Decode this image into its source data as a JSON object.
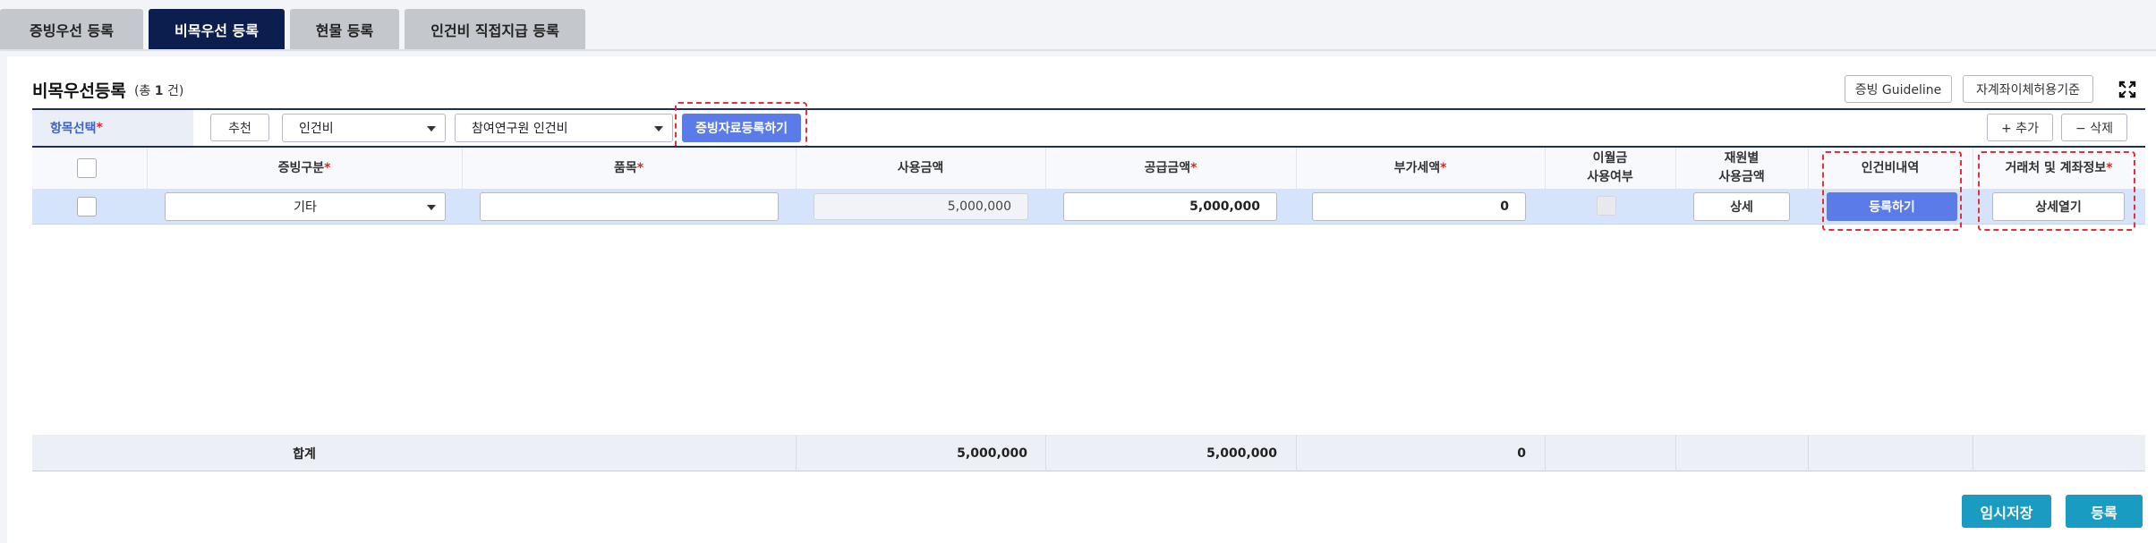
{
  "tabs": [
    "증빙우선 등록",
    "비목우선 등록",
    "현물 등록",
    "인건비 직접지급 등록"
  ],
  "header": {
    "title": "비목우선등록",
    "count_prefix": "(총 ",
    "count_value": "1",
    "count_suffix": " 건)",
    "guideline_button": "증빙 Guideline",
    "transfer_button": "자계좌이체허용기준",
    "expand_icon": "expand-icon"
  },
  "selector": {
    "label": "항목선택",
    "recommend_button": "추천",
    "category_value": "인건비",
    "subcategory_value": "참여연구원 인건비",
    "register_docs_button": "증빙자료등록하기",
    "add_button": "+ 추가",
    "delete_button": "− 삭제"
  },
  "table": {
    "headers": {
      "evidence_type": "증빙구분",
      "item": "품목",
      "usage_amount": "사용금액",
      "supply_amount": "공급금액",
      "vat": "부가세액",
      "carryover_line1": "이월금",
      "carryover_line2": "사용여부",
      "fund_line1": "재원별",
      "fund_line2": "사용금액",
      "personnel": "인건비내역",
      "vendor": "거래처 및 계좌정보"
    },
    "rows": [
      {
        "evidence_type": "기타",
        "item": "",
        "usage_amount": "5,000,000",
        "supply_amount": "5,000,000",
        "vat": "0",
        "fund_button": "상세",
        "personnel_button": "등록하기",
        "vendor_button": "상세열기"
      }
    ],
    "footer": {
      "label": "합계",
      "usage_amount": "5,000,000",
      "supply_amount": "5,000,000",
      "vat": "0"
    }
  },
  "actions": {
    "temp_save": "임시저장",
    "register": "등록"
  },
  "colors": {
    "active_tab": "#0c1e4d",
    "primary_button": "#5b7be8",
    "teal_button": "#1a9bc2",
    "required": "#e2231a",
    "highlight_dash": "#e0313a"
  }
}
